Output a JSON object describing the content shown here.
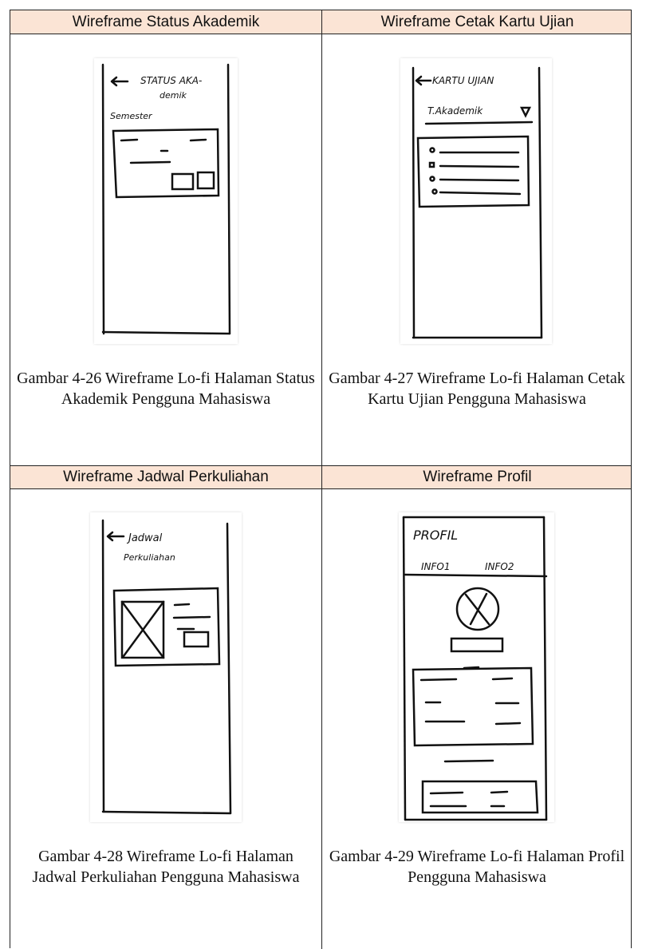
{
  "headers": {
    "status_akademik": "Wireframe Status Akademik",
    "cetak_kartu": "Wireframe Cetak Kartu Ujian",
    "jadwal": "Wireframe Jadwal Perkuliahan",
    "profil": "Wireframe Profil"
  },
  "captions": {
    "fig_26": "Gambar 4-26 Wireframe Lo-fi Halaman Status Akademik Pengguna Mahasiswa",
    "fig_27": "Gambar 4-27 Wireframe Lo-fi Halaman Cetak Kartu Ujian Pengguna Mahasiswa",
    "fig_28": "Gambar 4-28 Wireframe Lo-fi Halaman Jadwal Perkuliahan Pengguna Mahasiswa",
    "fig_29": "Gambar 4-29 Wireframe Lo-fi Halaman Profil Pengguna Mahasiswa"
  },
  "sketch_text": {
    "status_title_1": "STATUS AKA-",
    "status_title_2": "demik",
    "status_semester": "Semester",
    "kartu_title": "KARTU UJIAN",
    "kartu_dropdown": "T.Akademik",
    "jadwal_title_1": "Jadwal",
    "jadwal_title_2": "Perkuliahan",
    "profil_title": "PROFIL",
    "profil_tab_1": "INFO1",
    "profil_tab_2": "INFO2"
  }
}
